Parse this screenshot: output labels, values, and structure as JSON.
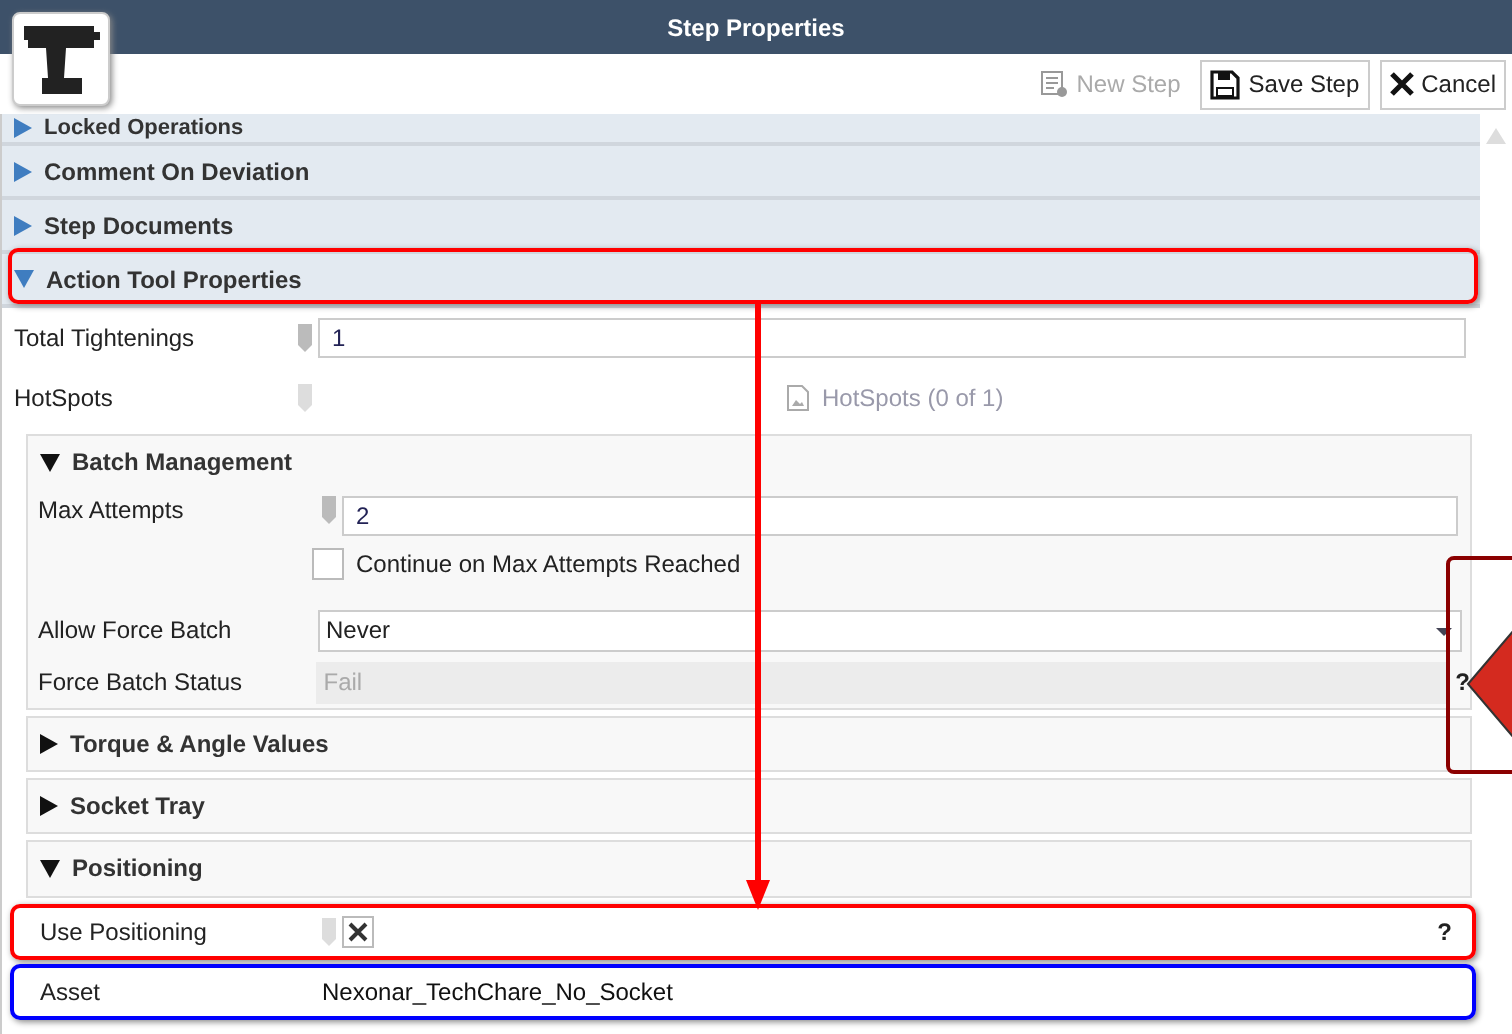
{
  "window": {
    "title": "Step Properties"
  },
  "toolbar": [
    {
      "label": "New Step",
      "kind": "new",
      "disabled": true
    },
    {
      "label": "Save Step",
      "kind": "save",
      "disabled": false
    },
    {
      "label": "Cancel",
      "kind": "cancel",
      "disabled": false
    }
  ],
  "sections": [
    {
      "label": "Locked Operations",
      "expanded": false
    },
    {
      "label": "Comment On Deviation",
      "expanded": false
    },
    {
      "label": "Step Documents",
      "expanded": false
    },
    {
      "label": "Action Tool Properties",
      "expanded": true
    }
  ],
  "total_tightenings": {
    "label": "Total Tightenings",
    "value": "1"
  },
  "hotspots": {
    "label": "HotSpots",
    "link": "HotSpots (0 of 1)"
  },
  "batch": {
    "label": "Batch Management",
    "expanded": true,
    "max_attempts": {
      "label": "Max Attempts",
      "value": "2"
    },
    "continue": {
      "label": "Continue on Max Attempts Reached",
      "checked": false
    },
    "allow_force": {
      "label": "Allow Force Batch",
      "value": "Never"
    },
    "force_status": {
      "label": "Force Batch Status",
      "value": "Fail",
      "disabled": true,
      "help": "?"
    }
  },
  "subsections": [
    {
      "label": "Torque & Angle Values",
      "expanded": false
    },
    {
      "label": "Socket Tray",
      "expanded": false
    }
  ],
  "positioning": {
    "label": "Positioning",
    "expanded": true,
    "use": {
      "label": "Use Positioning",
      "checked": true,
      "help": "?"
    },
    "asset": {
      "label": "Asset",
      "value": "Nexonar_TechChare_No_Socket"
    }
  }
}
